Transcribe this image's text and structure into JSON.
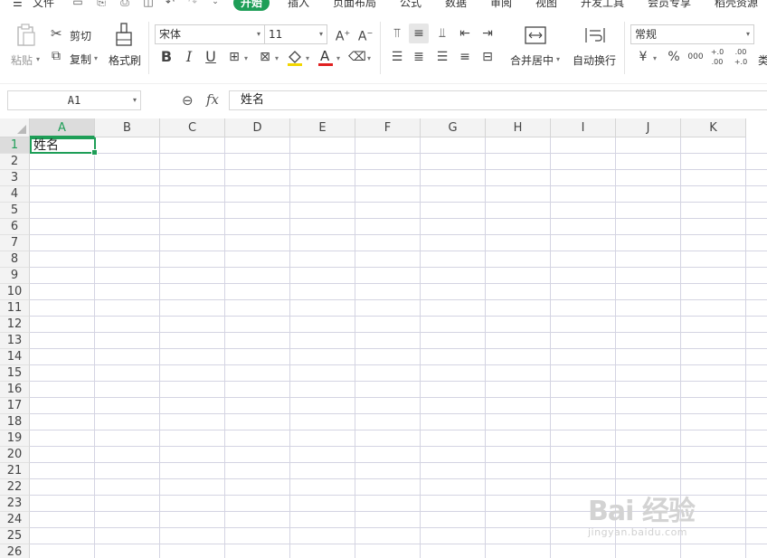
{
  "menu": {
    "file": "文件",
    "tabs": [
      "开始",
      "插入",
      "页面布局",
      "公式",
      "数据",
      "审阅",
      "视图",
      "开发工具",
      "会员专享",
      "稻壳资源"
    ]
  },
  "ribbon": {
    "paste": "粘贴",
    "cut": "剪切",
    "copy": "复制",
    "format_painter": "格式刷",
    "font_name": "宋体",
    "font_size": "11",
    "bold": "B",
    "italic": "I",
    "underline": "U",
    "merge_center": "合并居中",
    "wrap_text": "自动换行",
    "number_format": "常规",
    "currency": "¥",
    "percent": "%",
    "thousands": "000",
    "inc_decimal": "+.0 .00",
    "dec_decimal": ".00 +.0",
    "type_more": "类"
  },
  "formula_bar": {
    "name_box": "A1",
    "fx": "fx",
    "content": "姓名"
  },
  "sheet": {
    "columns": [
      "A",
      "B",
      "C",
      "D",
      "E",
      "F",
      "G",
      "H",
      "I",
      "J",
      "K"
    ],
    "rows": [
      "1",
      "2",
      "3",
      "4",
      "5",
      "6",
      "7",
      "8",
      "9",
      "10",
      "11",
      "12",
      "13",
      "14",
      "15",
      "16",
      "17",
      "18",
      "19",
      "20",
      "21",
      "22",
      "23",
      "24",
      "25",
      "26"
    ],
    "active_cell": "A1",
    "cells": {
      "A1": "姓名"
    }
  },
  "watermark": {
    "logo": "Bai  经验",
    "url": "jingyan.baidu.com"
  },
  "colors": {
    "accent": "#1e9e57",
    "gridline": "#d4d4e2",
    "header_bg": "#f3f3f3"
  }
}
